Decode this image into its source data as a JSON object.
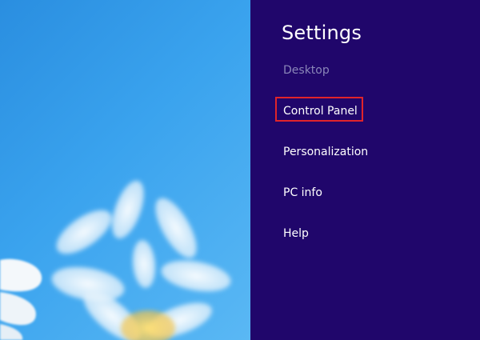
{
  "charm": {
    "title": "Settings",
    "context_label": "Desktop",
    "items": [
      {
        "label": "Control Panel"
      },
      {
        "label": "Personalization"
      },
      {
        "label": "PC info"
      },
      {
        "label": "Help"
      }
    ],
    "highlighted_item": "Control Panel",
    "highlight_color": "#e0242a",
    "background_color": "#20066b"
  },
  "desktop": {
    "background_color": "#3aa3ee",
    "wallpaper": "daisy-flower-image"
  }
}
